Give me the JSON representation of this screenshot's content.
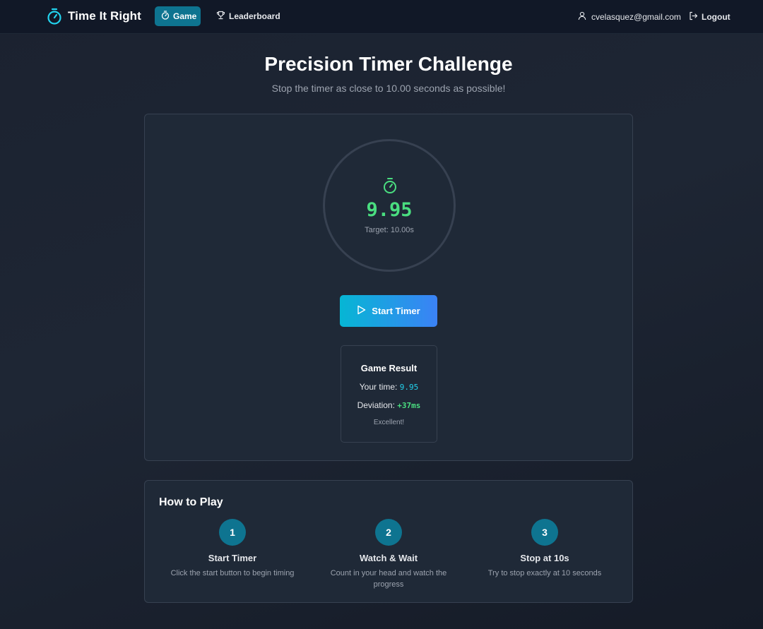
{
  "nav": {
    "brand": "Time It Right",
    "game_label": "Game",
    "leaderboard_label": "Leaderboard",
    "user_email": "cvelasquez@gmail.com",
    "logout_label": "Logout",
    "brand_icon": "stopwatch-icon",
    "leaderboard_icon": "trophy-icon",
    "user_icon": "user-icon",
    "logout_icon": "logout-icon"
  },
  "header": {
    "title": "Precision Timer Challenge",
    "subtitle": "Stop the timer as close to 10.00 seconds as possible!"
  },
  "timer": {
    "value": "9.95",
    "target_label": "Target: 10.00s",
    "icon": "stopwatch-icon",
    "start_label": "Start Timer",
    "start_icon": "play-icon"
  },
  "result": {
    "title": "Game Result",
    "time_label": "Your time:",
    "time_value": "9.95",
    "deviation_label": "Deviation:",
    "deviation_value": "+37ms",
    "verdict": "Excellent!"
  },
  "how_to_play": {
    "title": "How to Play",
    "steps": [
      {
        "number": "1",
        "title": "Start Timer",
        "description": "Click the start button to begin timing"
      },
      {
        "number": "2",
        "title": "Watch & Wait",
        "description": "Count in your head and watch the progress"
      },
      {
        "number": "3",
        "title": "Stop at 10s",
        "description": "Try to stop exactly at 10 seconds"
      }
    ]
  },
  "colors": {
    "accent_cyan": "#0e7490",
    "timer_green": "#4ade80",
    "time_cyan": "#22d3ee",
    "button_gradient_start": "#06b6d4",
    "button_gradient_end": "#3b82f6"
  }
}
